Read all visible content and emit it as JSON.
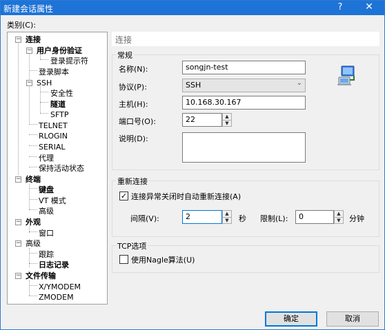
{
  "window": {
    "title": "新建会话属性",
    "help_glyph": "?",
    "close_glyph": "✕"
  },
  "category": {
    "label": "类别(C):",
    "tree": [
      {
        "label": "连接",
        "bold": true,
        "toggle": "−"
      },
      {
        "label": "用户身份验证",
        "bold": true,
        "toggle": "−"
      },
      {
        "label": "登录提示符",
        "bold": false
      },
      {
        "label": "登录脚本",
        "bold": false
      },
      {
        "label": "SSH",
        "bold": false,
        "toggle": "−"
      },
      {
        "label": "安全性",
        "bold": false
      },
      {
        "label": "隧道",
        "bold": true
      },
      {
        "label": "SFTP",
        "bold": false
      },
      {
        "label": "TELNET",
        "bold": false
      },
      {
        "label": "RLOGIN",
        "bold": false
      },
      {
        "label": "SERIAL",
        "bold": false
      },
      {
        "label": "代理",
        "bold": false
      },
      {
        "label": "保持活动状态",
        "bold": false
      },
      {
        "label": "终端",
        "bold": true,
        "toggle": "−"
      },
      {
        "label": "键盘",
        "bold": true
      },
      {
        "label": "VT 模式",
        "bold": false
      },
      {
        "label": "高级",
        "bold": false
      },
      {
        "label": "外观",
        "bold": true,
        "toggle": "−"
      },
      {
        "label": "窗口",
        "bold": false
      },
      {
        "label": "高级",
        "bold": false,
        "toggle": "−"
      },
      {
        "label": "跟踪",
        "bold": false
      },
      {
        "label": "日志记录",
        "bold": true
      },
      {
        "label": "文件传输",
        "bold": true,
        "toggle": "−"
      },
      {
        "label": "X/YMODEM",
        "bold": false
      },
      {
        "label": "ZMODEM",
        "bold": false
      }
    ]
  },
  "section_header": "连接",
  "general": {
    "legend": "常规",
    "name_label": "名称(N):",
    "name_value": "songjn-test",
    "protocol_label": "协议(P):",
    "protocol_value": "SSH",
    "host_label": "主机(H):",
    "host_value": "10.168.30.167",
    "port_label": "端口号(O):",
    "port_value": "22",
    "desc_label": "说明(D):",
    "desc_value": ""
  },
  "reconnect": {
    "legend": "重新连接",
    "auto_checkbox_label": "连接异常关闭时自动重新连接(A)",
    "auto_checked": true,
    "interval_label": "间隔(V):",
    "interval_value": "2",
    "interval_unit": "秒",
    "limit_label": "限制(L):",
    "limit_value": "0",
    "limit_unit": "分钟"
  },
  "tcp": {
    "legend": "TCP选项",
    "nagle_label": "使用Nagle算法(U)",
    "nagle_checked": false
  },
  "buttons": {
    "ok": "确定",
    "cancel": "取消"
  },
  "glyphs": {
    "check": "✓",
    "dropdown": "⌄",
    "up": "▲",
    "down": "▼"
  }
}
